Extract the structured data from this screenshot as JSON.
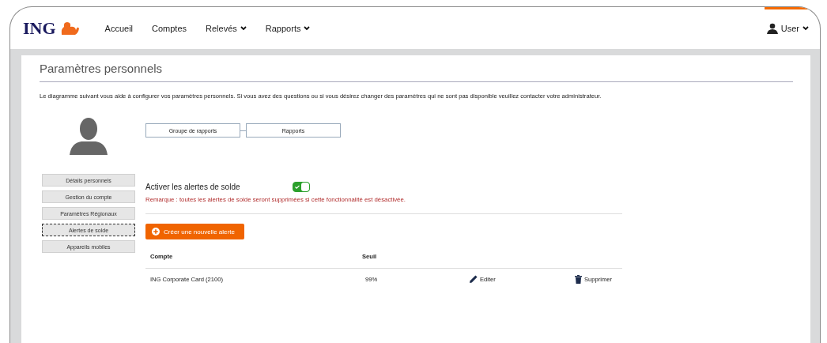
{
  "brand": {
    "name": "ING"
  },
  "nav": [
    {
      "label": "Accueil",
      "dropdown": false
    },
    {
      "label": "Comptes",
      "dropdown": false
    },
    {
      "label": "Relevés",
      "dropdown": true
    },
    {
      "label": "Rapports",
      "dropdown": true
    }
  ],
  "user_menu": {
    "label": "User",
    "selected": true
  },
  "page": {
    "title": "Paramètres personnels",
    "description": "Le diagramme suivant vous aide à configurer vos paramètres personnels. Si vous avez des questions ou si vous désirez changer des paramètres qui ne sont pas disponible veuillez contacter votre administrateur."
  },
  "diagram": [
    "Groupe de rapports",
    "Rapports"
  ],
  "sidebar": {
    "items": [
      {
        "label": "Détails personnels",
        "selected": false
      },
      {
        "label": "Gestion du compte",
        "selected": false
      },
      {
        "label": "Paramètres Régionaux",
        "selected": false
      },
      {
        "label": "Alertes de solde",
        "selected": true
      },
      {
        "label": "Appareils mobiles",
        "selected": false
      }
    ]
  },
  "alerts": {
    "toggle_label": "Activer les alertes de solde",
    "on": true,
    "remark": "Remarque : toutes les alertes de solde seront supprimées si cette fonctionnalité est désactivée.",
    "create_button": "Créer une nouvelle alerte"
  },
  "table": {
    "columns": [
      "Compte",
      "Seuil"
    ],
    "rows": [
      {
        "account": "ING Corporate Card (2100)",
        "threshold": "99%",
        "edit": "Editer",
        "delete": "Supprimer"
      }
    ]
  }
}
